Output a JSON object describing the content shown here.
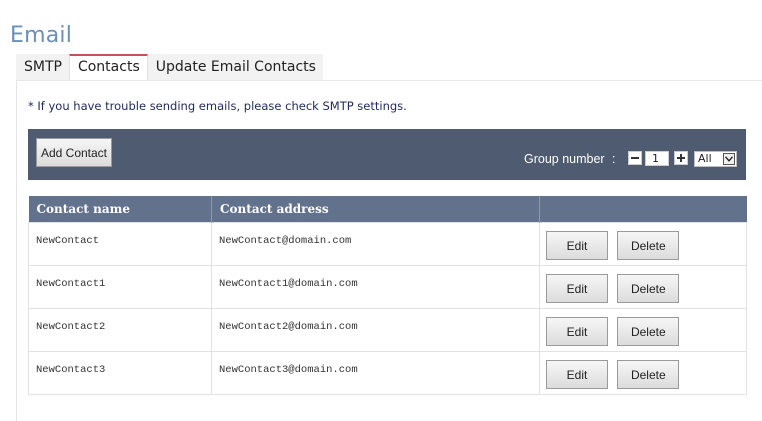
{
  "page": {
    "title": "Email"
  },
  "tabs": [
    {
      "label": "SMTP",
      "active": false
    },
    {
      "label": "Contacts",
      "active": true
    },
    {
      "label": "Update Email Contacts",
      "active": false
    }
  ],
  "notice": "* If you have trouble sending emails, please check SMTP settings.",
  "toolbar": {
    "add_label": "Add Contact",
    "group_label": "Group number",
    "group_sep": ":",
    "group_value": "1",
    "group_select": "All"
  },
  "table": {
    "headers": [
      "Contact name",
      "Contact address",
      ""
    ],
    "rows": [
      {
        "name": "NewContact",
        "address": "NewContact@domain.com",
        "edit": "Edit",
        "delete": "Delete"
      },
      {
        "name": "NewContact1",
        "address": "NewContact1@domain.com",
        "edit": "Edit",
        "delete": "Delete"
      },
      {
        "name": "NewContact2",
        "address": "NewContact2@domain.com",
        "edit": "Edit",
        "delete": "Delete"
      },
      {
        "name": "NewContact3",
        "address": "NewContact3@domain.com",
        "edit": "Edit",
        "delete": "Delete"
      }
    ]
  },
  "colors": {
    "title": "#6a8fb8",
    "toolbar_bg": "#4e5b70",
    "table_header_bg": "#63728c",
    "active_tab_accent": "#c85050"
  },
  "icons": [
    "minus-icon",
    "plus-icon",
    "chevron-down-icon"
  ]
}
